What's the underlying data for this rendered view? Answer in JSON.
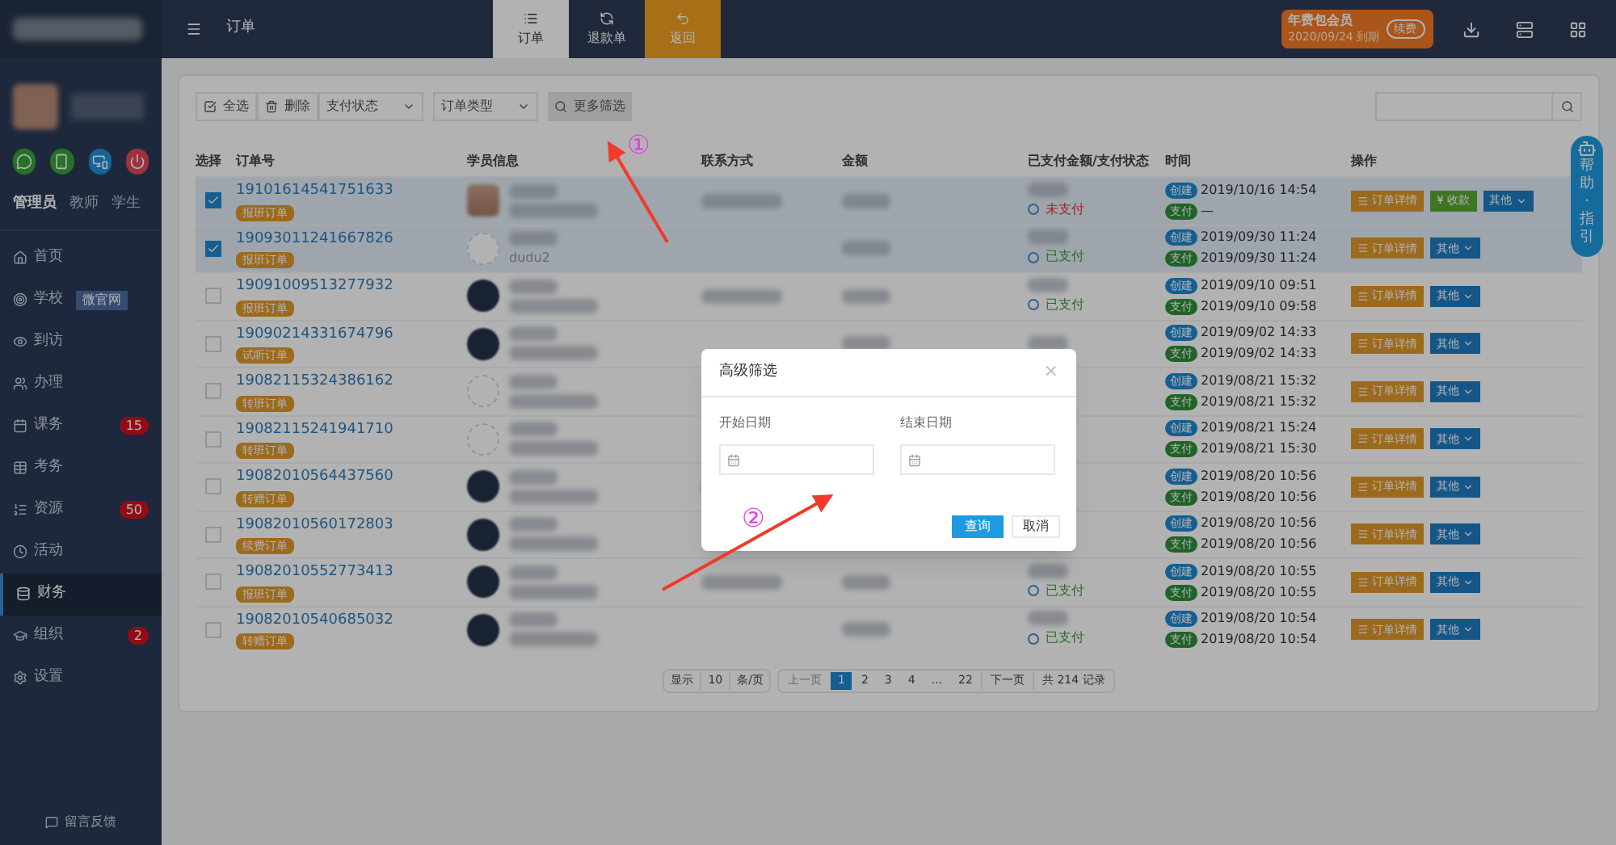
{
  "topbar": {
    "page_title": "订单",
    "tabs": [
      {
        "label": "订单",
        "selected": true,
        "kind": "list"
      },
      {
        "label": "退款单",
        "selected": false,
        "kind": "refund"
      },
      {
        "label": "返回",
        "selected": false,
        "kind": "back"
      }
    ],
    "membership": {
      "title": "年费包会员",
      "expiry": "2020/09/24 到期",
      "button": "续费"
    }
  },
  "sidebar": {
    "roles": [
      {
        "label": "管理员",
        "selected": true
      },
      {
        "label": "教师",
        "selected": false
      },
      {
        "label": "学生",
        "selected": false
      }
    ],
    "items": [
      {
        "label": "首页",
        "kind": "home",
        "selected": false
      },
      {
        "label": "学校",
        "kind": "target",
        "selected": false,
        "tag": "微官网"
      },
      {
        "label": "到访",
        "kind": "eye",
        "selected": false
      },
      {
        "label": "办理",
        "kind": "users",
        "selected": false
      },
      {
        "label": "课务",
        "kind": "calendar",
        "selected": false,
        "badge": "15"
      },
      {
        "label": "考务",
        "kind": "table",
        "selected": false
      },
      {
        "label": "资源",
        "kind": "list",
        "selected": false,
        "badge": "50"
      },
      {
        "label": "活动",
        "kind": "clock",
        "selected": false
      },
      {
        "label": "财务",
        "kind": "database",
        "selected": true
      },
      {
        "label": "组织",
        "kind": "cap",
        "selected": false,
        "badge": "2"
      },
      {
        "label": "设置",
        "kind": "gear",
        "selected": false
      }
    ],
    "feedback": "留言反馈"
  },
  "toolbar": {
    "select_all": "全选",
    "delete": "删除",
    "pay_status": "支付状态",
    "order_type": "订单类型",
    "more_filter": "更多筛选"
  },
  "table": {
    "columns": [
      "选择",
      "订单号",
      "学员信息",
      "联系方式",
      "金额",
      "已支付金额/支付状态",
      "时间",
      "操作"
    ],
    "rows": [
      {
        "checked": true,
        "order": "19101614541751633",
        "tag": "报班订单",
        "avatar": {
          "kind": "photo"
        },
        "status": {
          "text": "未支付",
          "kind": "unpaid"
        },
        "created_label": "创建",
        "created": "2019/10/16 14:54",
        "paid_label": "支付",
        "paid": "—",
        "actions": [
          "订单详情",
          "¥ 收款",
          "其他"
        ]
      },
      {
        "checked": true,
        "order": "19093011241667826",
        "tag": "报班订单",
        "avatar": {
          "kind": "empty"
        },
        "student": "dudu2",
        "status": {
          "text": "已支付",
          "kind": "paid"
        },
        "created_label": "创建",
        "created": "2019/09/30 11:24",
        "paid_label": "支付",
        "paid": "2019/09/30 11:24",
        "actions": [
          "订单详情",
          "其他"
        ]
      },
      {
        "checked": false,
        "order": "19091009513277932",
        "tag": "报班订单",
        "avatar": {
          "kind": "dark"
        },
        "status": {
          "text": "已支付",
          "kind": "paid"
        },
        "created_label": "创建",
        "created": "2019/09/10 09:51",
        "paid_label": "支付",
        "paid": "2019/09/10 09:58",
        "actions": [
          "订单详情",
          "其他"
        ]
      },
      {
        "checked": false,
        "order": "19090214331674796",
        "tag": "试听订单",
        "avatar": {
          "kind": "dark"
        },
        "created_label": "创建",
        "created": "2019/09/02 14:33",
        "paid_label": "支付",
        "paid": "2019/09/02 14:33",
        "actions": [
          "订单详情",
          "其他"
        ]
      },
      {
        "checked": false,
        "order": "19082115324386162",
        "tag": "转班订单",
        "avatar": {
          "kind": "empty"
        },
        "created_label": "创建",
        "created": "2019/08/21 15:32",
        "paid_label": "支付",
        "paid": "2019/08/21 15:32",
        "actions": [
          "订单详情",
          "其他"
        ]
      },
      {
        "checked": false,
        "order": "19082115241941710",
        "tag": "转班订单",
        "avatar": {
          "kind": "empty"
        },
        "created_label": "创建",
        "created": "2019/08/21 15:24",
        "paid_label": "支付",
        "paid": "2019/08/21 15:30",
        "actions": [
          "订单详情",
          "其他"
        ]
      },
      {
        "checked": false,
        "order": "19082010564437560",
        "tag": "转赠订单",
        "avatar": {
          "kind": "dark"
        },
        "created_label": "创建",
        "created": "2019/08/20 10:56",
        "paid_label": "支付",
        "paid": "2019/08/20 10:56",
        "actions": [
          "订单详情",
          "其他"
        ]
      },
      {
        "checked": false,
        "order": "19082010560172803",
        "tag": "续费订单",
        "avatar": {
          "kind": "dark"
        },
        "created_label": "创建",
        "created": "2019/08/20 10:56",
        "paid_label": "支付",
        "paid": "2019/08/20 10:56",
        "actions": [
          "订单详情",
          "其他"
        ]
      },
      {
        "checked": false,
        "order": "19082010552773413",
        "tag": "报班订单",
        "avatar": {
          "kind": "dark"
        },
        "status": {
          "text": "已支付",
          "kind": "paid"
        },
        "created_label": "创建",
        "created": "2019/08/20 10:55",
        "paid_label": "支付",
        "paid": "2019/08/20 10:55",
        "actions": [
          "订单详情",
          "其他"
        ]
      },
      {
        "checked": false,
        "order": "19082010540685032",
        "tag": "转赠订单",
        "avatar": {
          "kind": "dark"
        },
        "status": {
          "text": "已支付",
          "kind": "paid"
        },
        "created_label": "创建",
        "created": "2019/08/20 10:54",
        "paid_label": "支付",
        "paid": "2019/08/20 10:54",
        "actions": [
          "订单详情",
          "其他"
        ]
      }
    ]
  },
  "pagination": {
    "show": "显示",
    "page_size": "10",
    "per_page": "条/页",
    "prev": "上一页",
    "pages": [
      {
        "label": "1",
        "selected": true
      },
      {
        "label": "2",
        "selected": false
      },
      {
        "label": "3",
        "selected": false
      },
      {
        "label": "4",
        "selected": false
      },
      {
        "label": "...",
        "selected": false
      },
      {
        "label": "22",
        "selected": false
      }
    ],
    "next": "下一页",
    "total": "共 214 记录"
  },
  "help_tab": [
    "帮",
    "助",
    "·",
    "指",
    "引"
  ],
  "dialog": {
    "title": "高级筛选",
    "close": "×",
    "start_label": "开始日期",
    "end_label": "结束日期",
    "ok": "查询",
    "cancel": "取消"
  },
  "annotations": [
    "①",
    "②"
  ]
}
